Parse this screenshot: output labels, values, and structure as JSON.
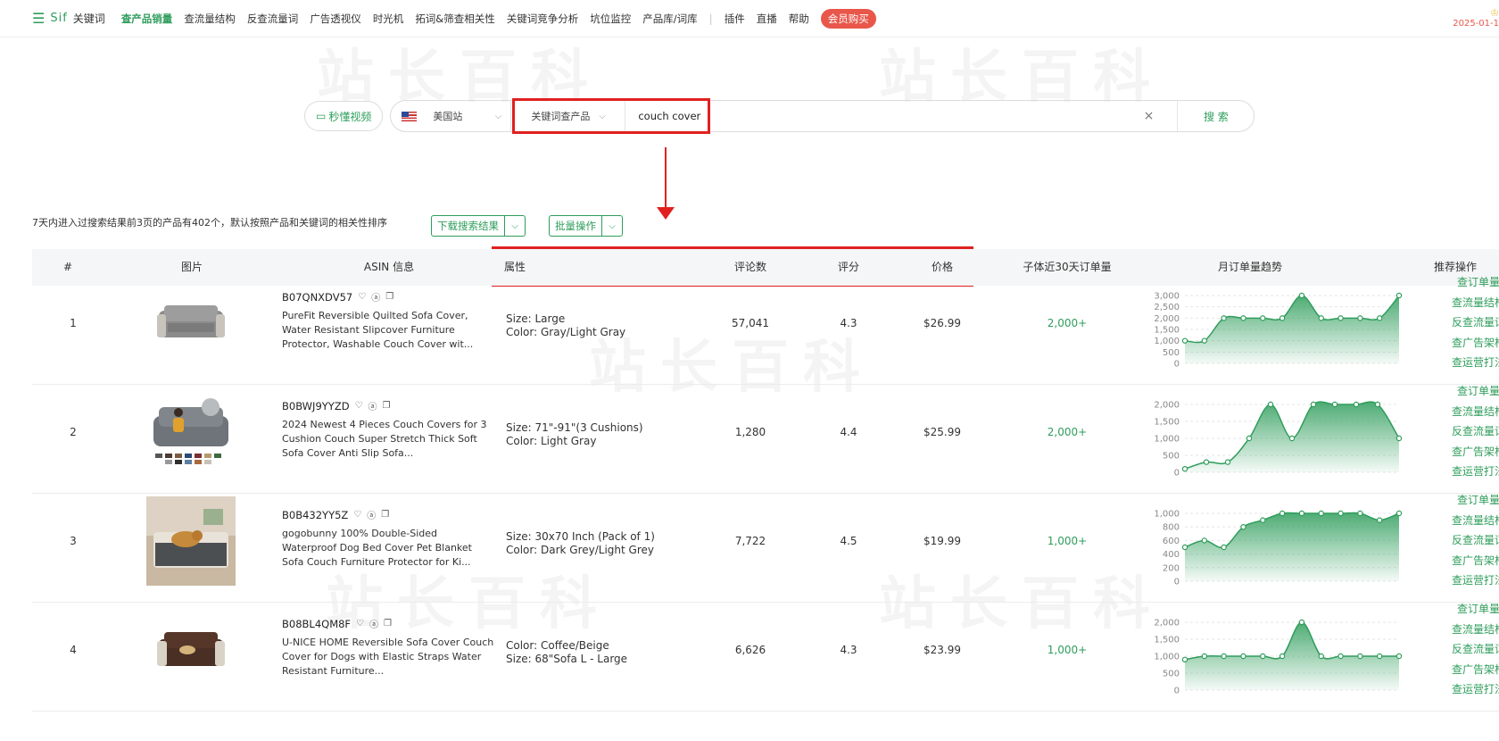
{
  "topbar": {
    "brand": "Sif",
    "product": "关键词",
    "nav": [
      "查产品销量",
      "查流量结构",
      "反查流量词",
      "广告透视仪",
      "时光机",
      "拓词&筛查相关性",
      "关键词竞争分析",
      "坑位监控",
      "产品库/词库"
    ],
    "nav_extra": [
      "插件",
      "直播",
      "帮助"
    ],
    "vip": "会员购买",
    "date": "2025-01-1",
    "accent": "#2e9d5b"
  },
  "watermark": "站长百科",
  "search": {
    "video_btn": "秒懂视频",
    "site": "美国站",
    "mode": "关键词查产品",
    "keyword": "couch cover",
    "clear_icon": "×",
    "button": "搜 索"
  },
  "summary": {
    "text": "7天内进入过搜索结果前3页的产品有402个，默认按照产品和关键词的相关性排序",
    "download": "下载搜索结果",
    "batch": "批量操作"
  },
  "table": {
    "headers": {
      "idx": "#",
      "image": "图片",
      "asin": "ASIN 信息",
      "attr": "属性",
      "reviews": "评论数",
      "rating": "评分",
      "price": "价格",
      "orders": "子体近30天订单量",
      "trend": "月订单量趋势",
      "ops": "推荐操作"
    },
    "ops_labels": [
      "查订单量",
      "查流量结构",
      "反查流量词",
      "查广告架构",
      "查运营打法"
    ],
    "rows": [
      {
        "idx": "1",
        "asin": "B07QNXDV57",
        "title": "PureFit Reversible Quilted Sofa Cover, Water Resistant Slipcover Furniture Protector, Washable Couch Cover wit...",
        "attr1": "Size: Large",
        "attr2": "Color: Gray/Light Gray",
        "reviews": "57,041",
        "rating": "4.3",
        "price": "$26.99",
        "orders": "2,000+",
        "trend_ticks": [
          "3,000",
          "2,500",
          "2,000",
          "1,500",
          "1,000",
          "500",
          "0"
        ],
        "trend_max": 3000,
        "trend": [
          1000,
          1000,
          2000,
          2000,
          2000,
          2000,
          3000,
          2000,
          2000,
          2000,
          2000,
          3000
        ]
      },
      {
        "idx": "2",
        "asin": "B0BWJ9YYZD",
        "title": "2024 Newest 4 Pieces Couch Covers for 3 Cushion Couch Super Stretch Thick Soft Sofa Cover Anti Slip Sofa...",
        "attr1": "Size: 71\"-91\"(3 Cushions)",
        "attr2": "Color: Light Gray",
        "reviews": "1,280",
        "rating": "4.4",
        "price": "$25.99",
        "orders": "2,000+",
        "trend_ticks": [
          "2,000",
          "1,500",
          "1,000",
          "500",
          "0"
        ],
        "trend_max": 2000,
        "trend": [
          100,
          300,
          300,
          1000,
          2000,
          1000,
          2000,
          2000,
          2000,
          2000,
          1000
        ]
      },
      {
        "idx": "3",
        "asin": "B0B432YY5Z",
        "title": "gogobunny 100% Double-Sided Waterproof Dog Bed Cover Pet Blanket Sofa Couch Furniture Protector for Ki...",
        "attr1": "Size: 30x70 Inch (Pack of 1)",
        "attr2": "Color: Dark Grey/Light Grey",
        "reviews": "7,722",
        "rating": "4.5",
        "price": "$19.99",
        "orders": "1,000+",
        "trend_ticks": [
          "1,000",
          "800",
          "600",
          "400",
          "200",
          "0"
        ],
        "trend_max": 1000,
        "trend": [
          500,
          600,
          500,
          800,
          900,
          1000,
          1000,
          1000,
          1000,
          1000,
          900,
          1000
        ]
      },
      {
        "idx": "4",
        "asin": "B08BL4QM8F",
        "title": "U-NICE HOME Reversible Sofa Cover Couch Cover for Dogs with Elastic Straps Water Resistant Furniture...",
        "attr1": "Color: Coffee/Beige",
        "attr2": "Size: 68\"Sofa L - Large",
        "reviews": "6,626",
        "rating": "4.3",
        "price": "$23.99",
        "orders": "1,000+",
        "trend_ticks": [
          "2,000",
          "1,500",
          "1,000",
          "500",
          "0"
        ],
        "trend_max": 2000,
        "trend": [
          900,
          1000,
          1000,
          1000,
          1000,
          1000,
          2000,
          1000,
          1000,
          1000,
          1000,
          1000
        ]
      }
    ]
  }
}
